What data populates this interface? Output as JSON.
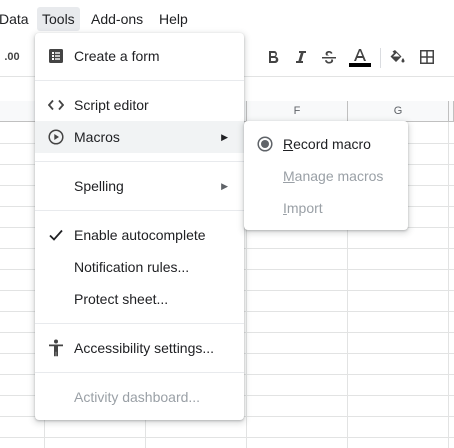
{
  "menubar": {
    "items": [
      {
        "label": "Data"
      },
      {
        "label": "Tools"
      },
      {
        "label": "Add-ons"
      },
      {
        "label": "Help"
      }
    ]
  },
  "toolbar": {
    "decimal_label": ".00"
  },
  "columns": [
    "F",
    "G"
  ],
  "tools_menu": {
    "items": [
      {
        "label": "Create a form",
        "icon": "form-icon"
      },
      {
        "label": "Script editor",
        "icon": "code-icon"
      },
      {
        "label": "Macros",
        "icon": "play-circle-icon",
        "has_submenu": true
      },
      {
        "label": "Spelling",
        "has_submenu": true
      },
      {
        "label": "Enable autocomplete",
        "icon": "check-icon"
      },
      {
        "label": "Notification rules..."
      },
      {
        "label": "Protect sheet..."
      },
      {
        "label": "Accessibility settings...",
        "icon": "accessibility-icon"
      },
      {
        "label": "Activity dashboard...",
        "disabled": true
      }
    ]
  },
  "macros_submenu": {
    "items": [
      {
        "label": "Record macro",
        "icon": "radio-icon",
        "underline_first": "R"
      },
      {
        "label": "Manage macros",
        "disabled": true,
        "underline_first": "M"
      },
      {
        "label": "Import",
        "disabled": true,
        "underline_first": "I"
      }
    ]
  },
  "colors": {
    "text": "#202124",
    "disabled_text": "#9aa0a6",
    "hover_bg": "#f1f3f4",
    "font_color_bar": "#000000"
  }
}
